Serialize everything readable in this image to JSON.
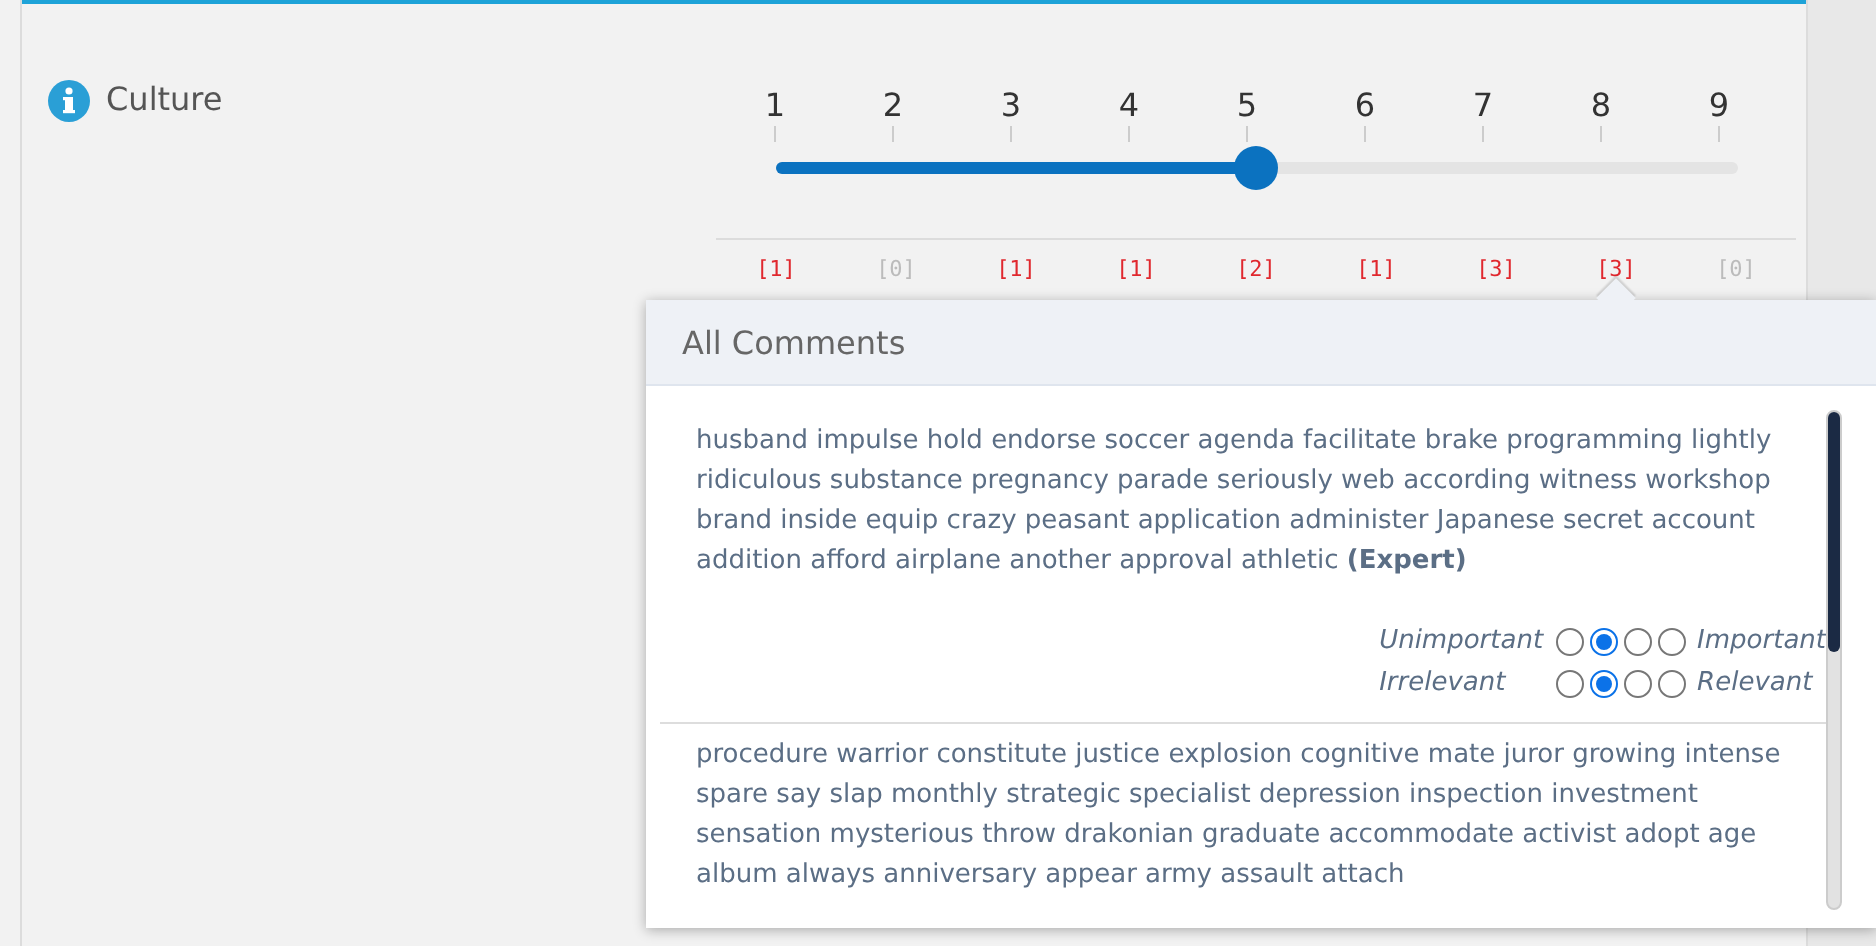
{
  "criterion": {
    "label": "Culture"
  },
  "scale": {
    "ticks": [
      "1",
      "2",
      "3",
      "4",
      "5",
      "6",
      "7",
      "8",
      "9"
    ],
    "level": 0.5
  },
  "counts": [
    {
      "text": "[1]",
      "empty": false
    },
    {
      "text": "[0]",
      "empty": true
    },
    {
      "text": "[1]",
      "empty": false
    },
    {
      "text": "[1]",
      "empty": false
    },
    {
      "text": "[2]",
      "empty": false
    },
    {
      "text": "[1]",
      "empty": false
    },
    {
      "text": "[3]",
      "empty": false
    },
    {
      "text": "[3]",
      "empty": false,
      "selected": true
    },
    {
      "text": "[0]",
      "empty": true
    }
  ],
  "popover": {
    "title": "All Comments",
    "comments": [
      {
        "text": "husband impulse hold endorse soccer agenda facilitate brake programming lightly ridiculous substance pregnancy parade seriously web according witness workshop brand inside equip crazy peasant application administer Japanese secret account addition afford airplane another approval athletic **(Expert)**",
        "ratings": [
          {
            "left": "Unimportant",
            "right": "Important",
            "options": [
              {
                "selected": false
              },
              {
                "selected": true
              },
              {
                "selected": false
              },
              {
                "selected": false
              }
            ]
          },
          {
            "left": "Irrelevant",
            "right": "Relevant",
            "options": [
              {
                "selected": false
              },
              {
                "selected": true
              },
              {
                "selected": false
              },
              {
                "selected": false
              }
            ]
          }
        ]
      },
      {
        "text": "procedure warrior constitute justice explosion cognitive mate juror growing intense spare say slap monthly strategic specialist depression inspection investment sensation mysterious throw drakonian graduate accommodate activist adopt age album always anniversary appear army assault attach"
      }
    ]
  }
}
